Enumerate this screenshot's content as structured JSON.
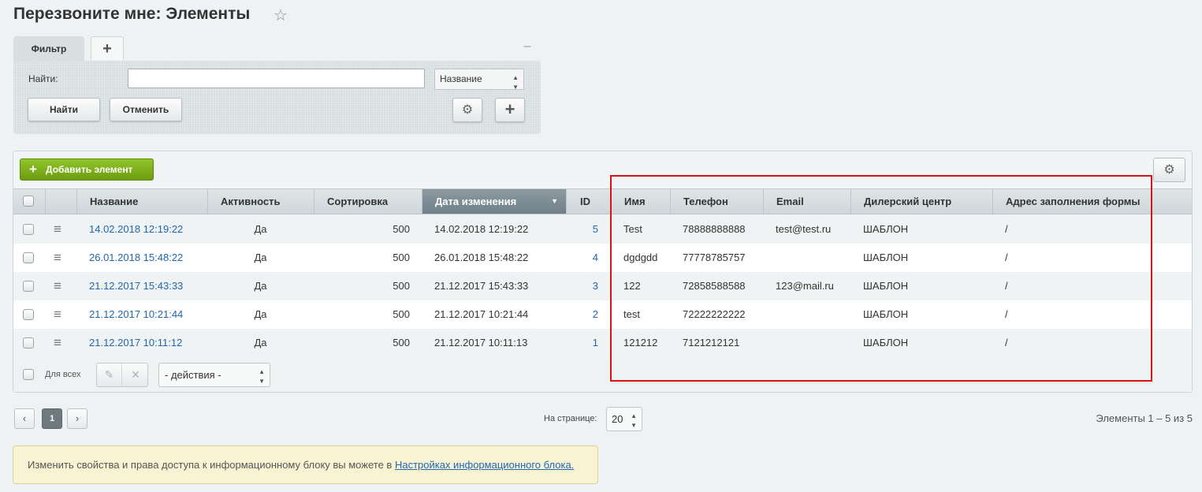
{
  "page": {
    "title": "Перезвоните мне: Элементы"
  },
  "filter": {
    "tab_label": "Фильтр",
    "find_label": "Найти:",
    "search_value": "",
    "field_select": "Название",
    "find_button": "Найти",
    "cancel_button": "Отменить"
  },
  "list": {
    "add_button": "Добавить элемент",
    "columns": [
      "Название",
      "Активность",
      "Сортировка",
      "Дата изменения",
      "ID",
      "Имя",
      "Телефон",
      "Email",
      "Дилерский центр",
      "Адрес заполнения формы"
    ],
    "rows": [
      {
        "name": "14.02.2018 12:19:22",
        "active": "Да",
        "sort": "500",
        "modified": "14.02.2018 12:19:22",
        "id": "5",
        "fname": "Test",
        "phone": "78888888888",
        "email": "test@test.ru",
        "dealer": "ШАБЛОН",
        "address": "/"
      },
      {
        "name": "26.01.2018 15:48:22",
        "active": "Да",
        "sort": "500",
        "modified": "26.01.2018 15:48:22",
        "id": "4",
        "fname": "dgdgdd",
        "phone": "77778785757",
        "email": "",
        "dealer": "ШАБЛОН",
        "address": "/"
      },
      {
        "name": "21.12.2017 15:43:33",
        "active": "Да",
        "sort": "500",
        "modified": "21.12.2017 15:43:33",
        "id": "3",
        "fname": "122",
        "phone": "72858588588",
        "email": "123@mail.ru",
        "dealer": "ШАБЛОН",
        "address": "/"
      },
      {
        "name": "21.12.2017 10:21:44",
        "active": "Да",
        "sort": "500",
        "modified": "21.12.2017 10:21:44",
        "id": "2",
        "fname": "test",
        "phone": "72222222222",
        "email": "",
        "dealer": "ШАБЛОН",
        "address": "/"
      },
      {
        "name": "21.12.2017 10:11:12",
        "active": "Да",
        "sort": "500",
        "modified": "21.12.2017 10:11:13",
        "id": "1",
        "fname": "121212",
        "phone": "7121212121",
        "email": "",
        "dealer": "ШАБЛОН",
        "address": "/"
      }
    ],
    "for_all_label": "Для всех",
    "actions_select": "- действия -"
  },
  "pager": {
    "current_page": "1",
    "per_page_label": "На странице:",
    "per_page_value": "20",
    "total_text": "Элементы 1 – 5 из 5"
  },
  "note": {
    "text": "Изменить свойства и права доступа к информационному блоку вы можете в",
    "link_text": "Настройках информационного блока."
  },
  "colors": {
    "accent_green": "#7aad17",
    "highlight_red": "#d8121a",
    "link": "#2067b0"
  }
}
